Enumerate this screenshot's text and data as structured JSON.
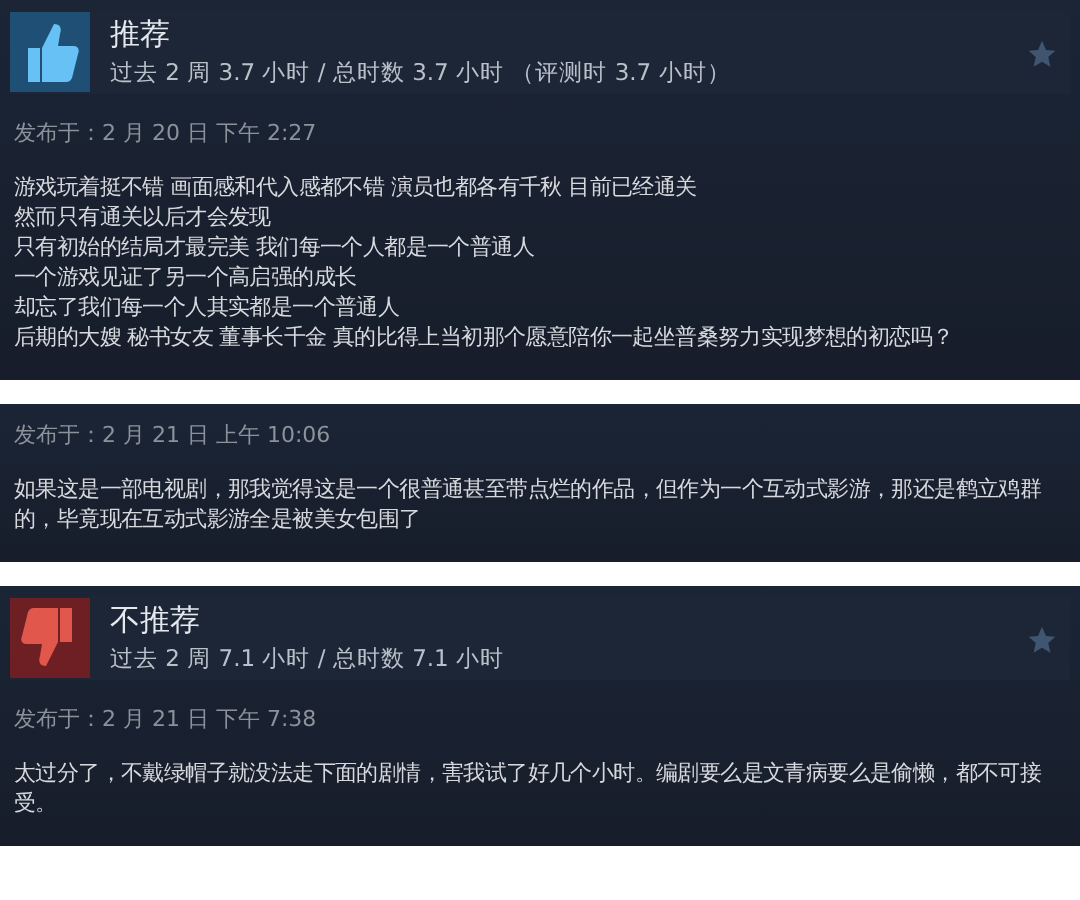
{
  "reviews": [
    {
      "header": {
        "kind": "recommended",
        "title": "推荐",
        "hours": "过去 2 周 3.7 小时 / 总时数 3.7 小时 （评测时 3.7 小时）"
      },
      "posted": "发布于：2 月 20 日 下午 2:27",
      "body": [
        "游戏玩着挺不错 画面感和代入感都不错 演员也都各有千秋 目前已经通关",
        "然而只有通关以后才会发现",
        "只有初始的结局才最完美 我们每一个人都是一个普通人",
        "一个游戏见证了另一个高启强的成长",
        "却忘了我们每一个人其实都是一个普通人",
        "后期的大嫂 秘书女友 董事长千金 真的比得上当初那个愿意陪你一起坐普桑努力实现梦想的初恋吗？"
      ]
    },
    {
      "posted": "发布于：2 月 21 日 上午 10:06",
      "body": [
        "如果这是一部电视剧，那我觉得这是一个很普通甚至带点烂的作品，但作为一个互动式影游，那还是鹤立鸡群的，毕竟现在互动式影游全是被美女包围了"
      ]
    },
    {
      "header": {
        "kind": "not_recommended",
        "title": "不推荐",
        "hours": "过去 2 周 7.1 小时 / 总时数 7.1 小时"
      },
      "posted": "发布于：2 月 21 日 下午 7:38",
      "body": [
        "太过分了，不戴绿帽子就没法走下面的剧情，害我试了好几个小时。编剧要么是文青病要么是偷懒，都不可接受。"
      ]
    }
  ]
}
